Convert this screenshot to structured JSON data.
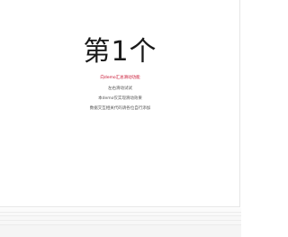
{
  "slide": {
    "headline": "第1个",
    "lines": [
      "向demo汇总滑动功能",
      "左右滑动试试",
      "本demo仅实现滑动效果",
      "数据交互相关代码请各位自行添加"
    ]
  },
  "colors": {
    "accent": "#c8102e",
    "text": "#1a1a1a",
    "muted": "#555555"
  }
}
